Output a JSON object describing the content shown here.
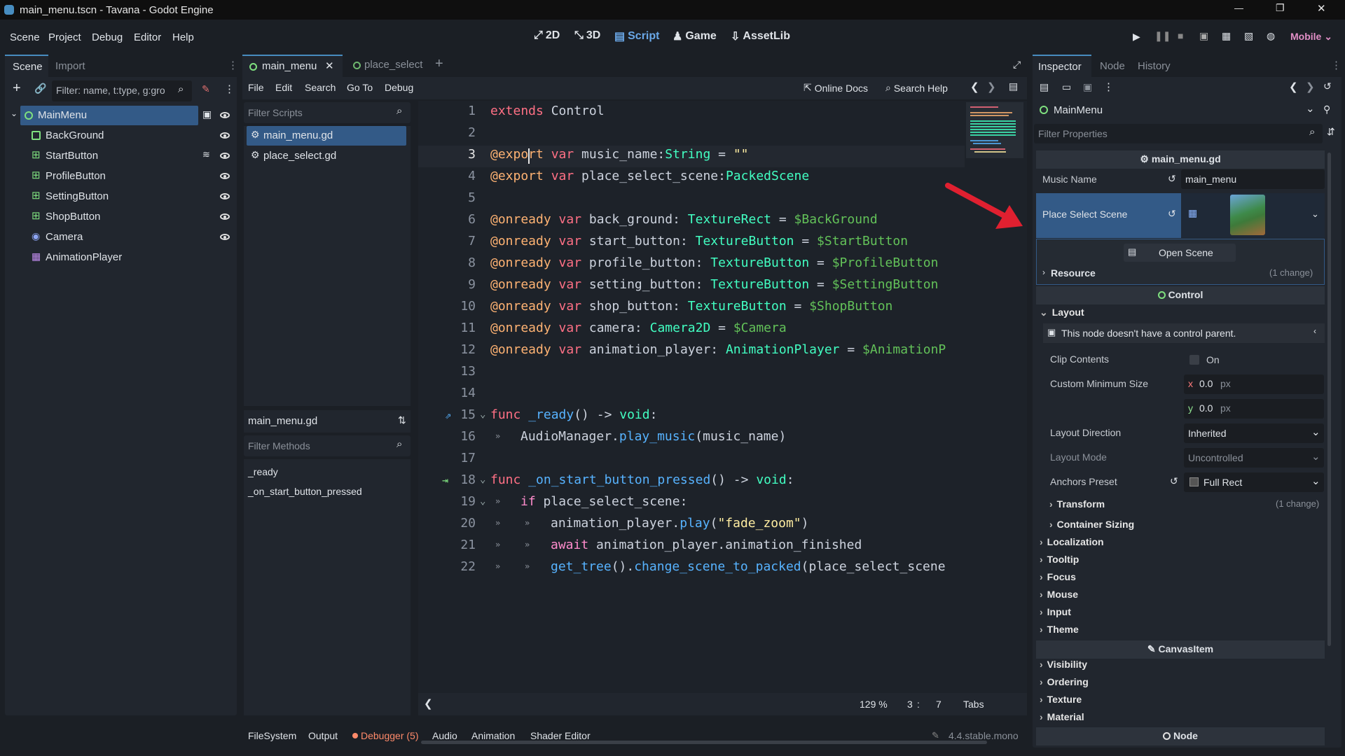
{
  "window": {
    "title": "main_menu.tscn - Tavana - Godot Engine",
    "minimize": "—",
    "restore": "❐",
    "close": "✕"
  },
  "menu": [
    "Scene",
    "Project",
    "Debug",
    "Editor",
    "Help"
  ],
  "workspaces": [
    "2D",
    "3D",
    "Script",
    "Game",
    "AssetLib"
  ],
  "renderer": "Mobile",
  "scene_dock": {
    "tabs": [
      "Scene",
      "Import"
    ],
    "filter_placeholder": "Filter: name, t:type, g:gro",
    "nodes": [
      "MainMenu",
      "BackGround",
      "StartButton",
      "ProfileButton",
      "SettingButton",
      "ShopButton",
      "Camera",
      "AnimationPlayer"
    ]
  },
  "script_tabs": [
    "main_menu",
    "place_select"
  ],
  "script_menu": [
    "File",
    "Edit",
    "Search",
    "Go To",
    "Debug"
  ],
  "online_docs": "Online Docs",
  "search_help": "Search Help",
  "scripts": {
    "filter_placeholder": "Filter Scripts",
    "items": [
      "main_menu.gd",
      "place_select.gd"
    ],
    "current": "main_menu.gd",
    "methods_placeholder": "Filter Methods",
    "methods": [
      "_ready",
      "_on_start_button_pressed"
    ]
  },
  "code": {
    "line_numbers": [
      "1",
      "2",
      "3",
      "4",
      "5",
      "6",
      "7",
      "8",
      "9",
      "10",
      "11",
      "12",
      "13",
      "14",
      "15",
      "16",
      "17",
      "18",
      "19",
      "20",
      "21",
      "22"
    ],
    "l1": {
      "kw": "extends",
      "rest": " Control"
    },
    "l3": {
      "ann": "@export",
      "kw": " var",
      "name": " music_name:",
      "type": "String",
      "rest": " = ",
      "str": "\"\""
    },
    "l4": {
      "ann": "@export",
      "kw": " var",
      "name": " place_select_scene:",
      "type": "PackedScene"
    },
    "onready": [
      {
        "var": " back_ground: ",
        "type": "TextureRect",
        "node": "$BackGround"
      },
      {
        "var": " start_button: ",
        "type": "TextureButton",
        "node": "$StartButton"
      },
      {
        "var": " profile_button: ",
        "type": "TextureButton",
        "node": "$ProfileButton"
      },
      {
        "var": " setting_button: ",
        "type": "TextureButton",
        "node": "$SettingButton"
      },
      {
        "var": " shop_button: ",
        "type": "TextureButton",
        "node": "$ShopButton"
      },
      {
        "var": " camera: ",
        "type": "Camera2D",
        "node": "$Camera"
      },
      {
        "var": " animation_player: ",
        "type": "AnimationPlayer",
        "node": "$AnimationP"
      }
    ],
    "ann_onready": "@onready",
    "kw_var": " var",
    "eq": " = ",
    "l14": {
      "kw": "func",
      "name": " _ready",
      "rest": "() -> ",
      "type": "void",
      "colon": ":"
    },
    "l15": {
      "obj": "AudioManager",
      "dot": ".",
      "fn": "play_music",
      "rest": "(music_name)"
    },
    "l17": {
      "kw": "func",
      "name": " _on_start_button_pressed",
      "rest": "() -> ",
      "type": "void",
      "colon": ":"
    },
    "l18": {
      "kw": "if",
      "rest": " place_select_scene:"
    },
    "l19": {
      "obj": "animation_player.",
      "fn": "play",
      "open": "(",
      "str": "\"fade_zoom\"",
      "close": ")"
    },
    "l20": {
      "kw": "await",
      "rest": " animation_player.animation_finished"
    },
    "l21": {
      "fn1": "get_tree",
      "mid": "().",
      "fn2": "change_scene_to_packed",
      "rest": "(place_select_scene"
    },
    "status": {
      "zoom": "129 %",
      "line": "3",
      "sep": ":",
      "col": "7",
      "indent": "Tabs"
    }
  },
  "bottom_tabs": [
    "FileSystem",
    "Output",
    "Debugger (5)",
    "Audio",
    "Animation",
    "Shader Editor"
  ],
  "version": "4.4.stable.mono",
  "inspector": {
    "tabs": [
      "Inspector",
      "Node",
      "History"
    ],
    "node": "MainMenu",
    "filter_placeholder": "Filter Properties",
    "script": "main_menu.gd",
    "music_name_label": "Music Name",
    "music_name_value": "main_menu",
    "place_select_label": "Place Select Scene",
    "open_scene": "Open Scene",
    "resource": "Resource",
    "resource_change": "(1 change)",
    "control": "Control",
    "layout": "Layout",
    "warning": "This node doesn't have a control parent.",
    "clip_contents": "Clip Contents",
    "on": "On",
    "custom_min_size": "Custom Minimum Size",
    "x": "x",
    "y": "y",
    "x_val": "0.0",
    "y_val": "0.0",
    "px": "px",
    "layout_direction": "Layout Direction",
    "layout_direction_val": "Inherited",
    "layout_mode": "Layout Mode",
    "layout_mode_val": "Uncontrolled",
    "anchors_preset": "Anchors Preset",
    "anchors_preset_val": "Full Rect",
    "transform": "Transform",
    "transform_change": "(1 change)",
    "container_sizing": "Container Sizing",
    "groups": [
      "Localization",
      "Tooltip",
      "Focus",
      "Mouse",
      "Input",
      "Theme"
    ],
    "canvas_item": "CanvasItem",
    "groups2": [
      "Visibility",
      "Ordering",
      "Texture",
      "Material"
    ],
    "node_section": "Node"
  },
  "colors": {
    "accent": "#478cbf",
    "selection": "#335a87",
    "arrow": "#e02030",
    "debugger": "#ff8a6a"
  }
}
